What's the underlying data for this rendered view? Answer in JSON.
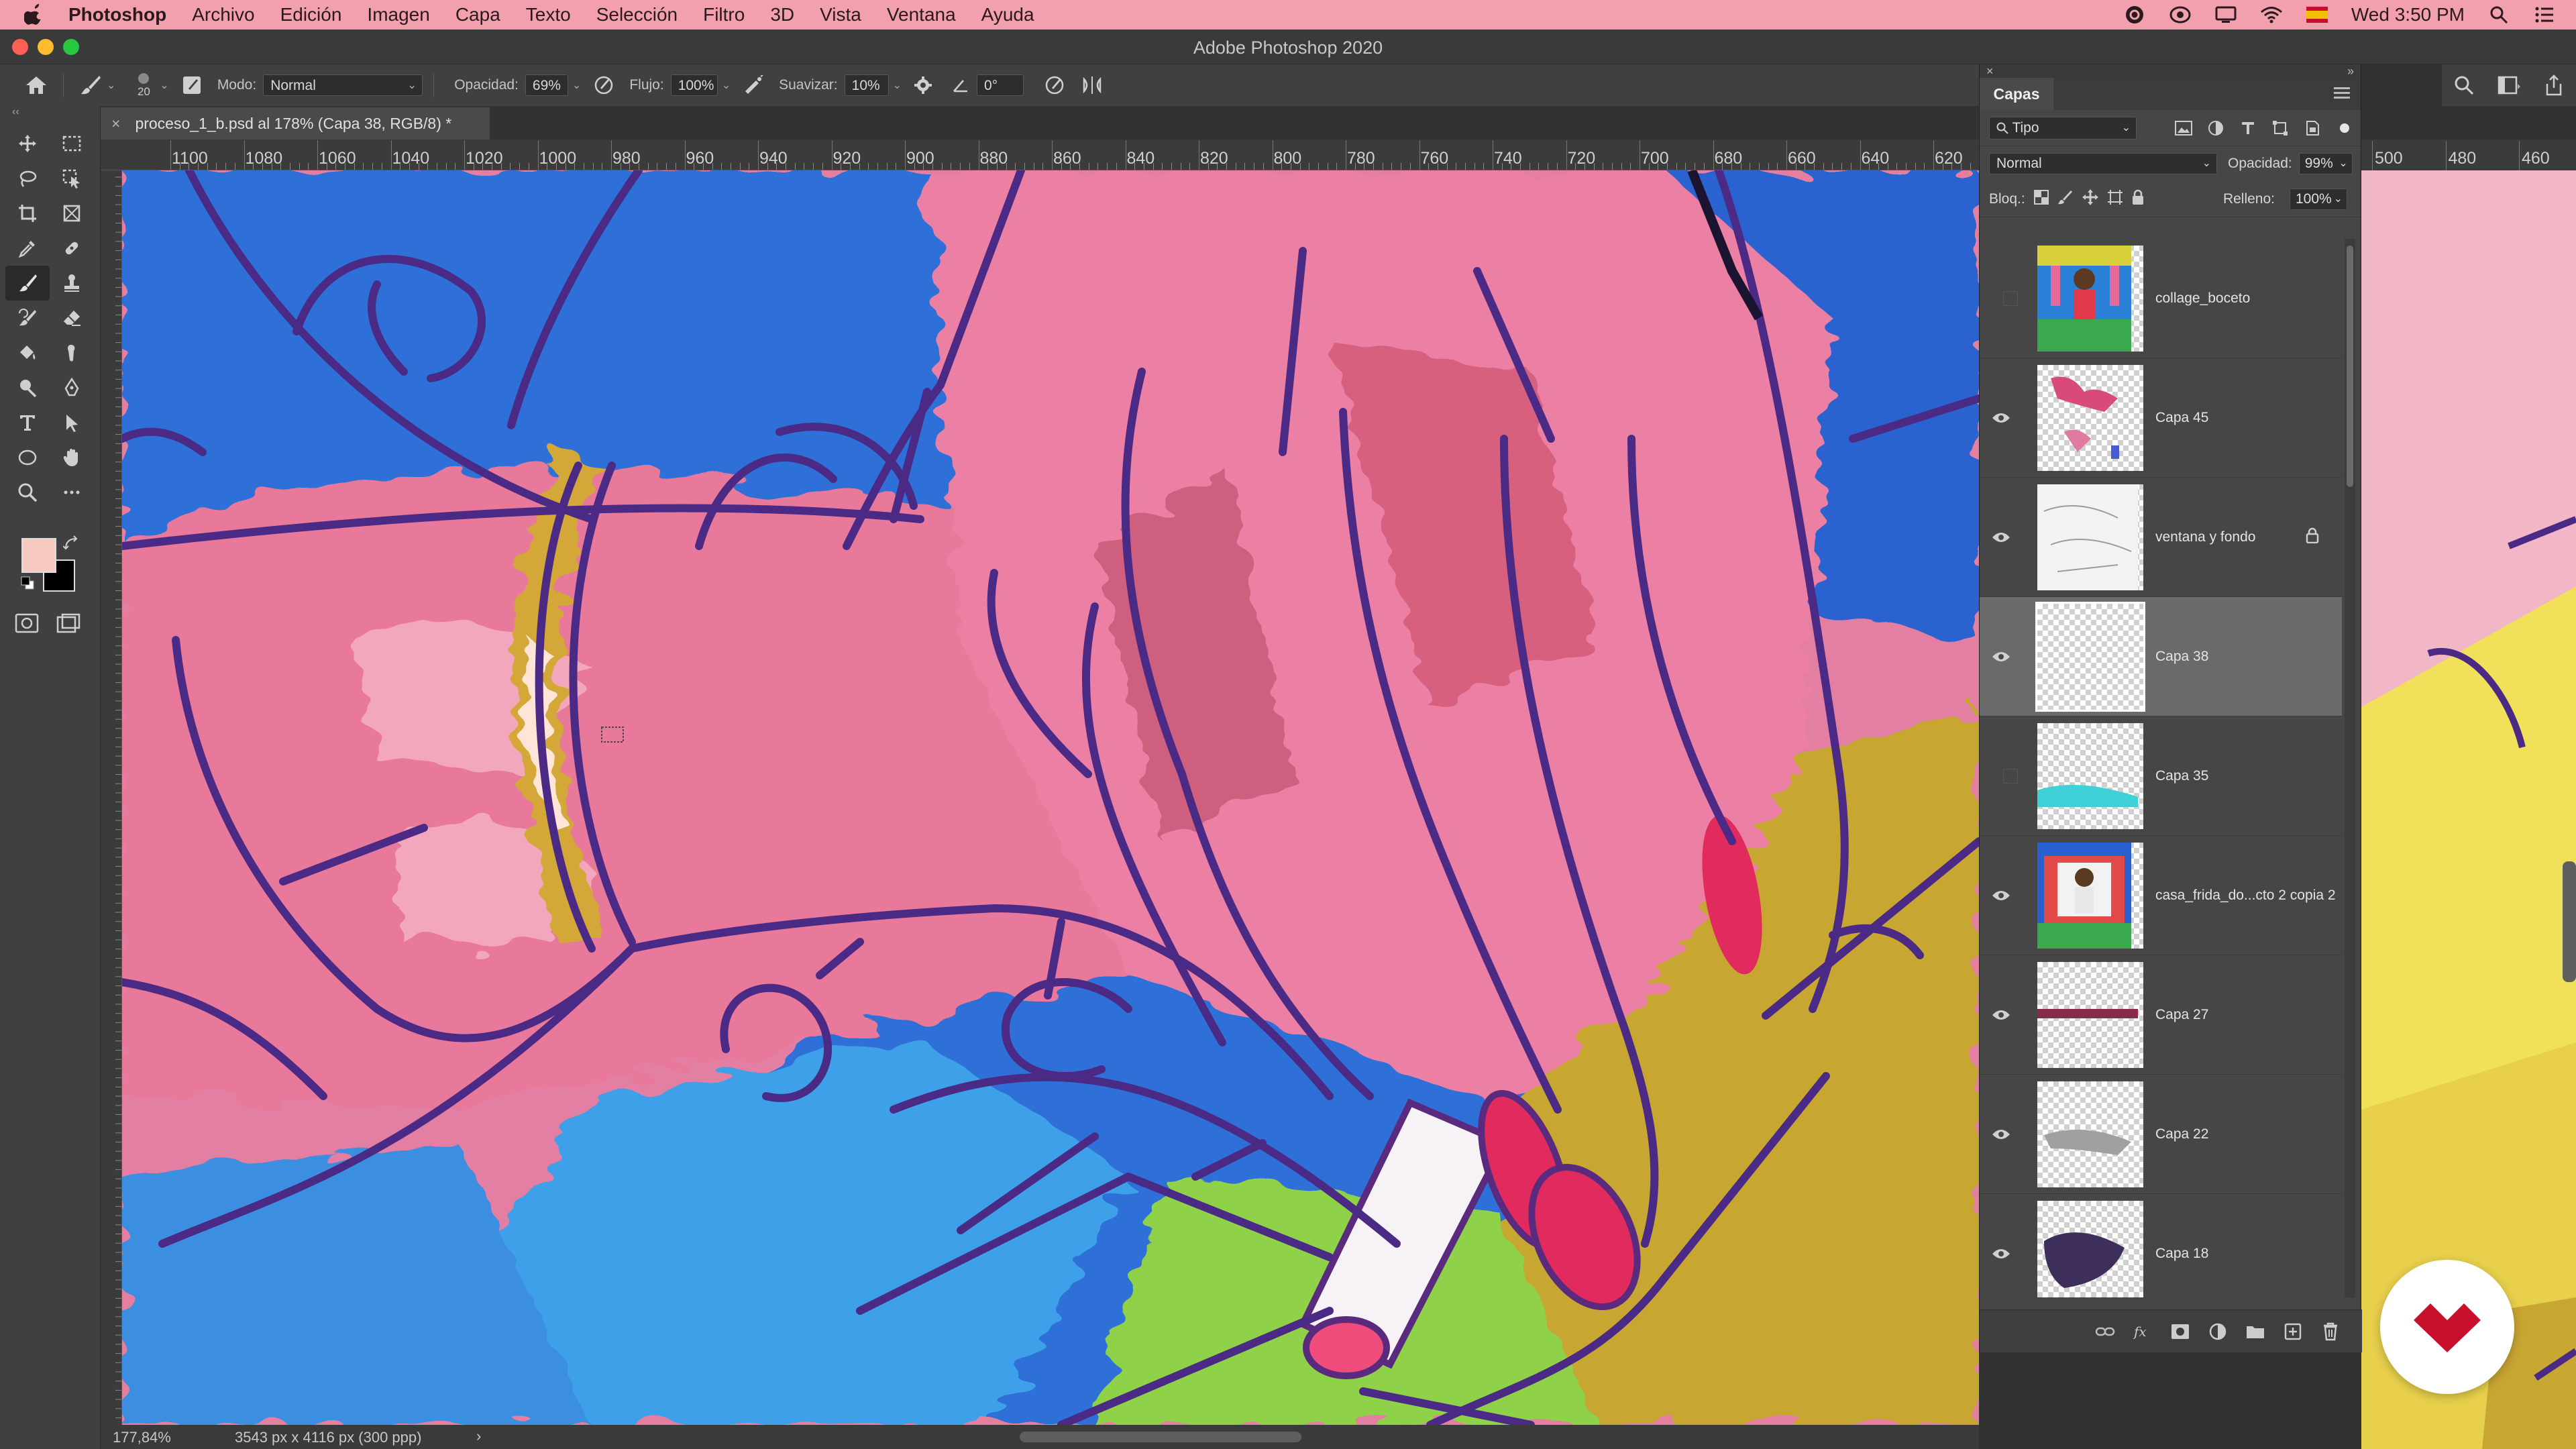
{
  "menubar": {
    "app_name": "Photoshop",
    "items": [
      "Archivo",
      "Edición",
      "Imagen",
      "Capa",
      "Texto",
      "Selección",
      "Filtro",
      "3D",
      "Vista",
      "Ventana",
      "Ayuda"
    ],
    "clock": "Wed 3:50 PM"
  },
  "window": {
    "title": "Adobe Photoshop 2020"
  },
  "options": {
    "brush_size": "20",
    "mode_label": "Modo:",
    "mode_value": "Normal",
    "opacity_label": "Opacidad:",
    "opacity_value": "69%",
    "flow_label": "Flujo:",
    "flow_value": "100%",
    "smoothing_label": "Suavizar:",
    "smoothing_value": "10%",
    "angle_value": "0°"
  },
  "document": {
    "tab_title": "proceso_1_b.psd al 178% (Capa 38, RGB/8) *"
  },
  "rulers": {
    "horizontal": [
      "1100",
      "1080",
      "1060",
      "1040",
      "1020",
      "1000",
      "980",
      "960",
      "940",
      "920",
      "900",
      "880",
      "860",
      "840",
      "820",
      "800",
      "780",
      "760",
      "740",
      "720",
      "700",
      "680",
      "660",
      "640",
      "620"
    ],
    "horizontal_right": [
      "500",
      "480",
      "460"
    ]
  },
  "status": {
    "zoom": "177,84%",
    "dimensions": "3543 px x 4116 px (300 ppp)",
    "arrow": "›"
  },
  "layers_panel": {
    "tab_label": "Capas",
    "filter_kind": "Tipo",
    "blend_mode": "Normal",
    "opacity_label": "Opacidad:",
    "opacity_value": "99%",
    "lock_label": "Bloq.:",
    "fill_label": "Relleno:",
    "fill_value": "100%",
    "layers": [
      {
        "name": "collage_boceto",
        "visible": false,
        "selected": false,
        "locked": false,
        "thumb": "collage"
      },
      {
        "name": "Capa 45",
        "visible": true,
        "selected": false,
        "locked": false,
        "thumb": "splash"
      },
      {
        "name": "ventana y fondo",
        "visible": true,
        "selected": false,
        "locked": true,
        "thumb": "sketch"
      },
      {
        "name": "Capa 38",
        "visible": true,
        "selected": true,
        "locked": false,
        "thumb": "empty"
      },
      {
        "name": "Capa 35",
        "visible": false,
        "selected": false,
        "locked": false,
        "thumb": "cyan"
      },
      {
        "name": "casa_frida_do...cto 2 copia 2",
        "visible": true,
        "selected": false,
        "locked": false,
        "thumb": "frida"
      },
      {
        "name": "Capa 27",
        "visible": true,
        "selected": false,
        "locked": false,
        "thumb": "stripe"
      },
      {
        "name": "Capa 22",
        "visible": true,
        "selected": false,
        "locked": false,
        "thumb": "gray"
      },
      {
        "name": "Capa 18",
        "visible": true,
        "selected": false,
        "locked": false,
        "thumb": "dark"
      }
    ]
  },
  "colors": {
    "foreground": "#f7c9c0",
    "background": "#000000",
    "menubar": "#f2a0ad",
    "brand": "#c8102e"
  }
}
